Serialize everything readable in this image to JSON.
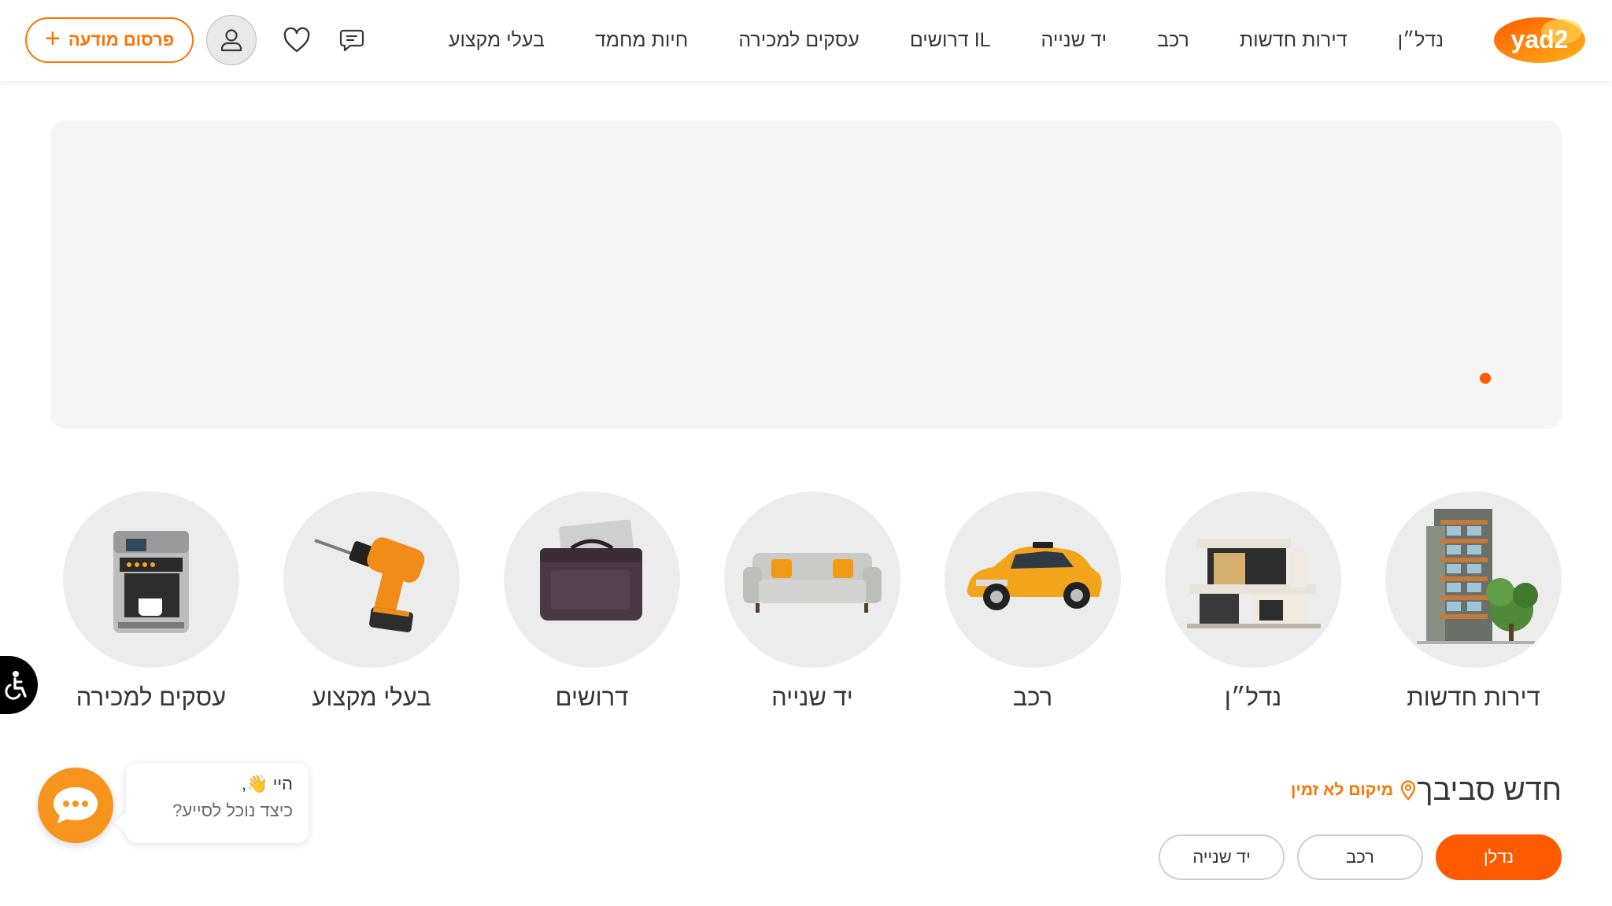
{
  "header": {
    "logo_text": "yad2",
    "nav": [
      {
        "id": "real-estate",
        "label": "נדל״ן"
      },
      {
        "id": "new-apartments",
        "label": "דירות חדשות"
      },
      {
        "id": "vehicles",
        "label": "רכב"
      },
      {
        "id": "second-hand",
        "label": "יד שנייה"
      },
      {
        "id": "wanted-il",
        "label": "דרושים IL"
      },
      {
        "id": "businesses-for-sale",
        "label": "עסקים למכירה"
      },
      {
        "id": "pets",
        "label": "חיות מחמד"
      },
      {
        "id": "professionals",
        "label": "בעלי מקצוע"
      }
    ],
    "publish_label": "פרסום מודעה",
    "publish_plus": "+"
  },
  "categories": [
    {
      "id": "new-apartments",
      "label": "דירות חדשות",
      "icon": "building-icon"
    },
    {
      "id": "real-estate",
      "label": "נדל״ן",
      "icon": "house-icon"
    },
    {
      "id": "vehicles",
      "label": "רכב",
      "icon": "car-icon"
    },
    {
      "id": "second-hand",
      "label": "יד שנייה",
      "icon": "sofa-icon"
    },
    {
      "id": "wanted",
      "label": "דרושים",
      "icon": "laptop-bag-icon"
    },
    {
      "id": "professionals",
      "label": "בעלי מקצוע",
      "icon": "drill-icon"
    },
    {
      "id": "businesses-for-sale",
      "label": "עסקים למכירה",
      "icon": "coffee-machine-icon"
    }
  ],
  "section": {
    "title": "חדש סביבך",
    "location_label": "מיקום לא זמין",
    "pills": [
      {
        "label": "נדלן",
        "active": true
      },
      {
        "label": "רכב",
        "active": false
      },
      {
        "label": "יד שנייה",
        "active": false
      }
    ]
  },
  "chat": {
    "greeting": "היי 👋,",
    "question": "כיצד נוכל לסייע?"
  },
  "colors": {
    "brand_orange": "#ff7100",
    "active_pill": "#ff5a00",
    "chat_orange": "#f7941d",
    "text": "#363636"
  }
}
